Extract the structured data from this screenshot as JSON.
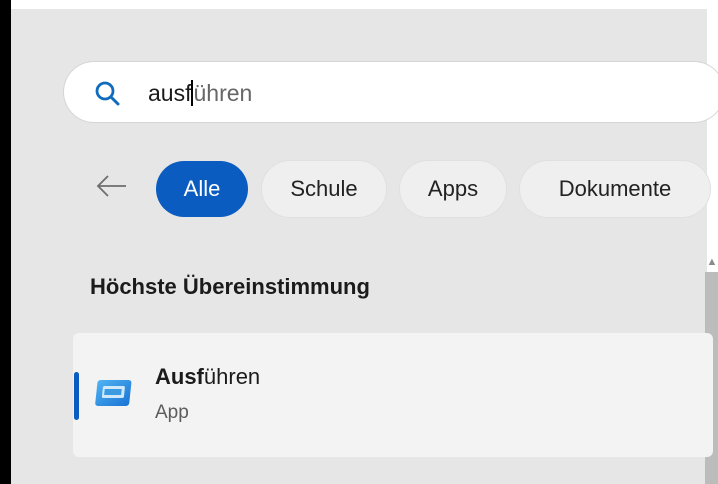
{
  "search": {
    "icon": "search-icon",
    "value_typed": "ausf",
    "value_suggested": "ühren"
  },
  "filters": {
    "back_icon": "back-arrow-icon",
    "chips": [
      {
        "label": "Alle",
        "active": true
      },
      {
        "label": "Schule",
        "active": false
      },
      {
        "label": "Apps",
        "active": false
      },
      {
        "label": "Dokumente",
        "active": false
      }
    ]
  },
  "best_match": {
    "section_title": "Höchste Übereinstimmung",
    "result": {
      "name_bold": "Ausf",
      "name_rest": "ühren",
      "type": "App",
      "icon": "run-dialog-icon"
    }
  },
  "colors": {
    "accent": "#0b5cc0",
    "panel": "#e6e6e6"
  }
}
